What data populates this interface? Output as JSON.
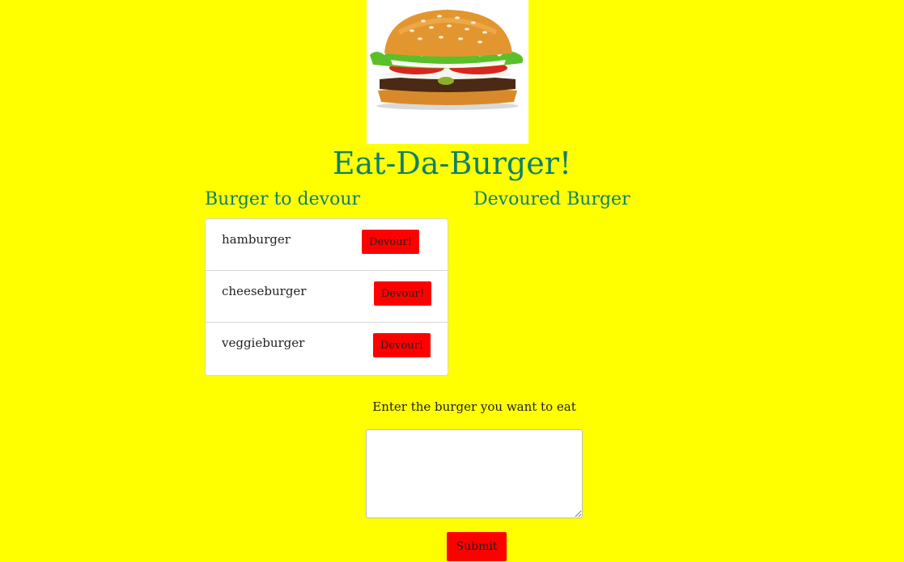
{
  "header": {
    "logo_icon": "burger-image",
    "title": "Eat-Da-Burger!"
  },
  "columns": {
    "to_devour_heading": "Burger to devour",
    "devoured_heading": "Devoured Burger"
  },
  "burgers_to_devour": [
    {
      "name": "hamburger",
      "button_label": "Devour!"
    },
    {
      "name": "cheeseburger",
      "button_label": "Devour!"
    },
    {
      "name": "veggieburger",
      "button_label": "Devour!"
    }
  ],
  "devoured_burgers": [],
  "form": {
    "label": "Enter the burger you want to eat",
    "value": "",
    "submit_label": "Submit"
  },
  "colors": {
    "background": "#ffff00",
    "heading": "#10806a",
    "button": "#ff0000"
  }
}
